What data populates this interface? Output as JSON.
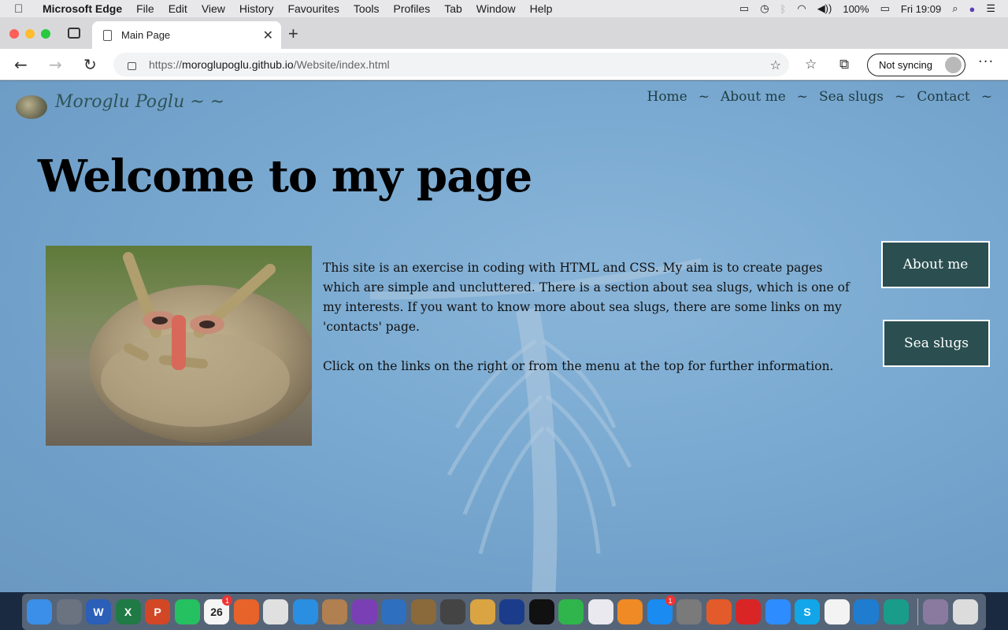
{
  "menubar": {
    "app_name": "Microsoft Edge",
    "items": [
      "File",
      "Edit",
      "View",
      "History",
      "Favourites",
      "Tools",
      "Profiles",
      "Tab",
      "Window",
      "Help"
    ],
    "battery": "100%",
    "clock": "Fri 19:09"
  },
  "browser": {
    "tab_title": "Main Page",
    "url_proto": "https://",
    "url_host": "moroglupoglu.github.io",
    "url_path": "/Website/index.html",
    "sync_label": "Not syncing"
  },
  "site": {
    "name": "Moroglu Poglu ~ ~",
    "nav": [
      "Home",
      "About me",
      "Sea slugs",
      "Contact"
    ],
    "nav_separator": "~",
    "headline": "Welcome to my page",
    "paragraph1": "This site is an exercise in coding with HTML and CSS. My aim is to create pages which are simple and uncluttered. There is a section about sea slugs, which is one of my interests. If you want to know more about sea slugs, there are some links on my 'contacts' page.",
    "paragraph2": "Click on the links on the right or from the menu at the top for further information.",
    "side_buttons": {
      "about": "About me",
      "slugs": "Sea slugs"
    }
  },
  "dock": {
    "apps": [
      {
        "name": "finder",
        "color": "#3b8fe8",
        "glyph": ""
      },
      {
        "name": "launchpad",
        "color": "#6b7280",
        "glyph": ""
      },
      {
        "name": "word",
        "color": "#2b5fb8",
        "glyph": "W"
      },
      {
        "name": "excel",
        "color": "#1f7a45",
        "glyph": "X"
      },
      {
        "name": "powerpoint",
        "color": "#d24726",
        "glyph": "P"
      },
      {
        "name": "whatsapp",
        "color": "#25c060",
        "glyph": ""
      },
      {
        "name": "calendar",
        "color": "#f5f5f5",
        "glyph": "26",
        "badge": "1"
      },
      {
        "name": "firefox",
        "color": "#e8632a",
        "glyph": ""
      },
      {
        "name": "chrome",
        "color": "#e0e0e0",
        "glyph": ""
      },
      {
        "name": "safari",
        "color": "#2a8fe0",
        "glyph": ""
      },
      {
        "name": "contacts",
        "color": "#b08050",
        "glyph": ""
      },
      {
        "name": "music-app",
        "color": "#7b3fb5",
        "glyph": ""
      },
      {
        "name": "musescore",
        "color": "#2f6fbf",
        "glyph": ""
      },
      {
        "name": "guitar-app",
        "color": "#8a6a3a",
        "glyph": ""
      },
      {
        "name": "utility",
        "color": "#444",
        "glyph": ""
      },
      {
        "name": "preview",
        "color": "#d9a441",
        "glyph": ""
      },
      {
        "name": "audio-app",
        "color": "#1b3c8a",
        "glyph": ""
      },
      {
        "name": "garage-app",
        "color": "#111",
        "glyph": ""
      },
      {
        "name": "facetime",
        "color": "#2fb54b",
        "glyph": ""
      },
      {
        "name": "itunes",
        "color": "#e9e9ef",
        "glyph": ""
      },
      {
        "name": "books",
        "color": "#f08a24",
        "glyph": ""
      },
      {
        "name": "app-store",
        "color": "#1a8bf0",
        "glyph": "",
        "badge": "1"
      },
      {
        "name": "system-preferences",
        "color": "#7a7a7a",
        "glyph": ""
      },
      {
        "name": "spiral-app",
        "color": "#e35b2a",
        "glyph": ""
      },
      {
        "name": "acrobat",
        "color": "#d92525",
        "glyph": ""
      },
      {
        "name": "zoom",
        "color": "#2d8cff",
        "glyph": ""
      },
      {
        "name": "skype",
        "color": "#12a6e8",
        "glyph": "S"
      },
      {
        "name": "slack",
        "color": "#f3f3f3",
        "glyph": ""
      },
      {
        "name": "vscode",
        "color": "#1f7ccf",
        "glyph": ""
      },
      {
        "name": "edge",
        "color": "#1a9c8a",
        "glyph": ""
      }
    ],
    "right": [
      {
        "name": "downloads",
        "color": "#8a7aa0"
      },
      {
        "name": "trash",
        "color": "#dcdcdc"
      }
    ]
  }
}
